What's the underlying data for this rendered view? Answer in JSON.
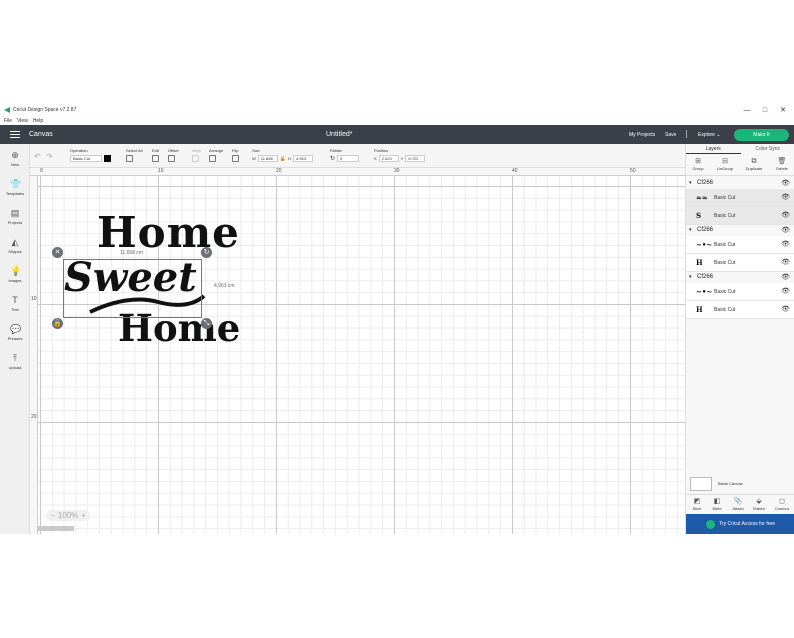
{
  "window": {
    "title": "Cricut Design Space  v7.2.87",
    "minimize": "—",
    "maximize": "□",
    "close": "✕"
  },
  "menu": [
    "File",
    "View",
    "Help"
  ],
  "header": {
    "canvas_label": "Canvas",
    "doc_title": "Untitled*",
    "my_projects": "My Projects",
    "save": "Save",
    "explore": "Explore ⌄",
    "make_it": "Make It"
  },
  "toolbar": {
    "operation_label": "Operation",
    "operation_value": "Basic Cut",
    "select_all": "Select All",
    "edit": "Edit",
    "offset": "Offset",
    "align": "Align",
    "arrange": "Arrange",
    "flip": "Flip",
    "size": "Size",
    "w_label": "W",
    "w_value": "11.658",
    "h_label": "H",
    "h_value": "4.963",
    "rotate": "Rotate",
    "rotate_value": "0",
    "position": "Position",
    "x_label": "X",
    "x_value": "2.023",
    "y_label": "Y",
    "y_value": "6.722"
  },
  "sidebar": {
    "items": [
      {
        "label": "New",
        "icon": "plus-icon"
      },
      {
        "label": "Templates",
        "icon": "shirt-icon"
      },
      {
        "label": "Projects",
        "icon": "projects-icon"
      },
      {
        "label": "Shapes",
        "icon": "shapes-icon"
      },
      {
        "label": "Images",
        "icon": "images-icon"
      },
      {
        "label": "Text",
        "icon": "text-icon"
      },
      {
        "label": "Phrases",
        "icon": "phrases-icon"
      },
      {
        "label": "Upload",
        "icon": "upload-icon"
      }
    ]
  },
  "ruler": {
    "top": [
      "0",
      "10",
      "20",
      "30",
      "40",
      "50"
    ],
    "left": [
      "10",
      "20"
    ]
  },
  "canvas": {
    "design_words": [
      "Home",
      "Sweet",
      "Home"
    ],
    "width_label": "11,658 cm",
    "height_label": "4,963 cm",
    "zoom": "100%"
  },
  "right_panel": {
    "tabs": [
      "Layers",
      "Color Sync"
    ],
    "actions": [
      "Group",
      "UnGroup",
      "Duplicate",
      "Delete"
    ],
    "groups": [
      {
        "name": "Cf266",
        "layers": [
          {
            "label": "Basic Cut",
            "thumb": "≈≈"
          },
          {
            "label": "Basic Cut",
            "thumb": "S"
          }
        ]
      },
      {
        "name": "Cf266",
        "layers": [
          {
            "label": "Basic Cut",
            "thumb": "~•~"
          },
          {
            "label": "Basic Cut",
            "thumb": "H"
          }
        ]
      },
      {
        "name": "Cf266",
        "layers": [
          {
            "label": "Basic Cut",
            "thumb": "~•~"
          },
          {
            "label": "Basic Cut",
            "thumb": "H"
          }
        ]
      }
    ],
    "blank_canvas": "Blank Canvas",
    "bottom_actions": [
      "Slice",
      "Weld",
      "Attach",
      "Flatten",
      "Contour"
    ],
    "cricut_access": "Try Cricut Access for free"
  }
}
